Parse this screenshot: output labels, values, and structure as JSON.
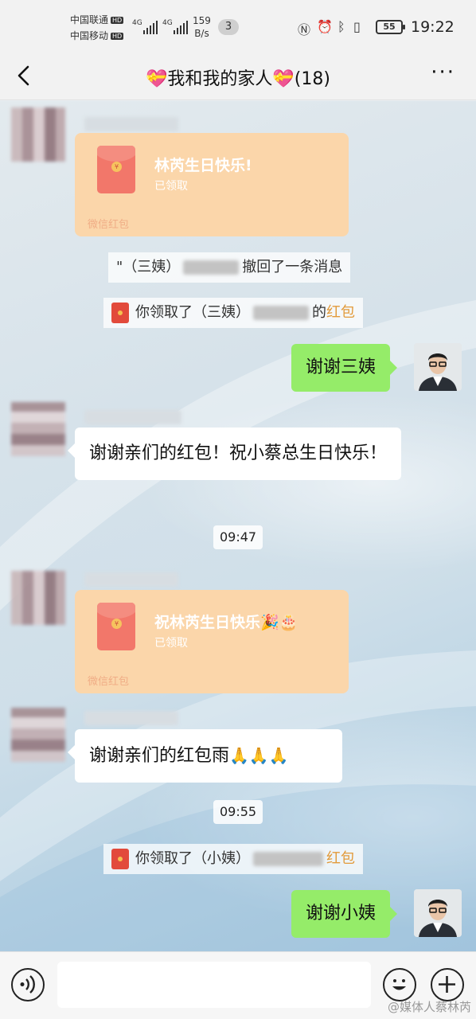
{
  "status_bar": {
    "carrier1": "中国联通",
    "carrier2": "中国移动",
    "hd": "HD",
    "net1": "4G",
    "net2": "4G",
    "speed_value": "159",
    "speed_unit": "B/s",
    "notif_count": "3",
    "battery": "55",
    "time": "19:22"
  },
  "header": {
    "title": "💝我和我的家人💝(18)",
    "more_label": "···"
  },
  "messages": {
    "rp1_title": "林芮生日快乐!",
    "rp1_status": "已领取",
    "rp1_footer": "微信红包",
    "recall_prefix": "\"（三姨）",
    "recall_suffix": "撤回了一条消息",
    "claim1_prefix": "你领取了（三姨）",
    "claim1_mid": "的",
    "claim1_hb": "红包",
    "out1": "谢谢三姨",
    "in1": "谢谢亲们的红包！祝小蔡总生日快乐！",
    "time1": "09:47",
    "rp2_title": "祝林芮生日快乐🎉🎂",
    "rp2_status": "已领取",
    "rp2_footer": "微信红包",
    "in2_text": "谢谢亲们的红包雨",
    "in2_emoji": "🙏🙏🙏",
    "time2": "09:55",
    "claim2_prefix": "你领取了（小姨）",
    "claim2_hb": "红包",
    "out2": "谢谢小姨"
  },
  "watermark": "@媒体人蔡林芮",
  "colors": {
    "bubble_out": "#95ec69",
    "redpacket": "#fbd6aa",
    "hongbao_text": "#e29a3a"
  }
}
